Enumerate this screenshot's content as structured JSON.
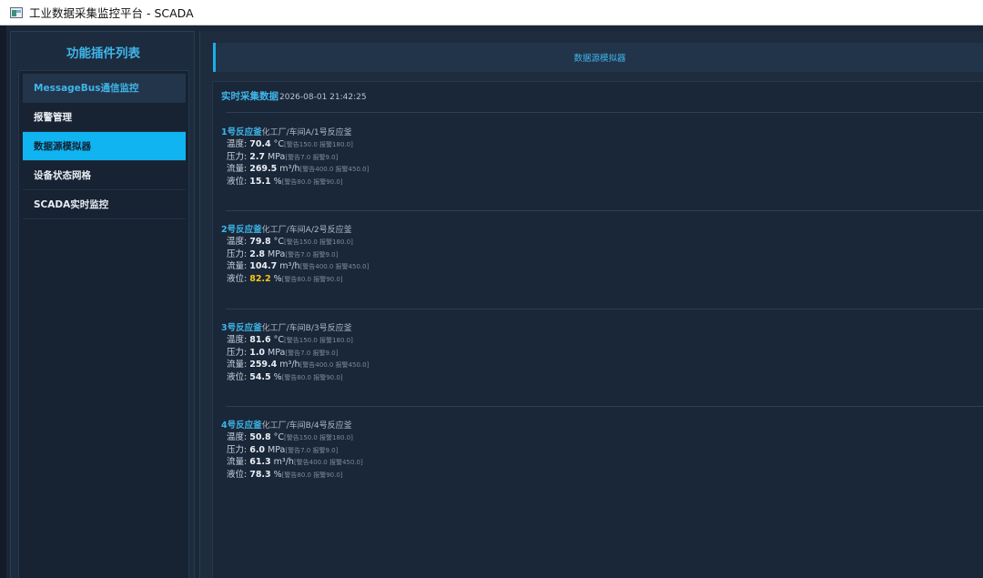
{
  "window": {
    "title": "工业数据采集监控平台 - SCADA"
  },
  "sidebar": {
    "title": "功能插件列表",
    "items": [
      {
        "label": "MessageBus通信监控"
      },
      {
        "label": "报警管理"
      },
      {
        "label": "数据源模拟器"
      },
      {
        "label": "设备状态网格"
      },
      {
        "label": "SCADA实时监控"
      }
    ]
  },
  "main": {
    "header_title": "数据源模拟器",
    "realtime": {
      "label": "实时采集数据",
      "timestamp": "2026-08-01 21:42:25"
    },
    "reactors": [
      {
        "name": "1号反应釜",
        "path": "化工厂/车间A/1号反应釜",
        "metrics": [
          {
            "label": "温度:",
            "value": "70.4",
            "unit": "°C",
            "thresholds": "[警告150.0 报警180.0]",
            "warn": false
          },
          {
            "label": "压力:",
            "value": "2.7",
            "unit": "MPa",
            "thresholds": "[警告7.0 报警9.0]",
            "warn": false
          },
          {
            "label": "流量:",
            "value": "269.5",
            "unit": "m³/h",
            "thresholds": "[警告400.0 报警450.0]",
            "warn": false
          },
          {
            "label": "液位:",
            "value": "15.1",
            "unit": "%",
            "thresholds": "[警告80.0 报警90.0]",
            "warn": false
          }
        ]
      },
      {
        "name": "2号反应釜",
        "path": "化工厂/车间A/2号反应釜",
        "metrics": [
          {
            "label": "温度:",
            "value": "79.8",
            "unit": "°C",
            "thresholds": "[警告150.0 报警180.0]",
            "warn": false
          },
          {
            "label": "压力:",
            "value": "2.8",
            "unit": "MPa",
            "thresholds": "[警告7.0 报警9.0]",
            "warn": false
          },
          {
            "label": "流量:",
            "value": "104.7",
            "unit": "m³/h",
            "thresholds": "[警告400.0 报警450.0]",
            "warn": false
          },
          {
            "label": "液位:",
            "value": "82.2",
            "unit": "%",
            "thresholds": "[警告80.0 报警90.0]",
            "warn": true
          }
        ]
      },
      {
        "name": "3号反应釜",
        "path": "化工厂/车间B/3号反应釜",
        "metrics": [
          {
            "label": "温度:",
            "value": "81.6",
            "unit": "°C",
            "thresholds": "[警告150.0 报警180.0]",
            "warn": false
          },
          {
            "label": "压力:",
            "value": "1.0",
            "unit": "MPa",
            "thresholds": "[警告7.0 报警9.0]",
            "warn": false
          },
          {
            "label": "流量:",
            "value": "259.4",
            "unit": "m³/h",
            "thresholds": "[警告400.0 报警450.0]",
            "warn": false
          },
          {
            "label": "液位:",
            "value": "54.5",
            "unit": "%",
            "thresholds": "[警告80.0 报警90.0]",
            "warn": false
          }
        ]
      },
      {
        "name": "4号反应釜",
        "path": "化工厂/车间B/4号反应釜",
        "metrics": [
          {
            "label": "温度:",
            "value": "50.8",
            "unit": "°C",
            "thresholds": "[警告150.0 报警180.0]",
            "warn": false
          },
          {
            "label": "压力:",
            "value": "6.0",
            "unit": "MPa",
            "thresholds": "[警告7.0 报警9.0]",
            "warn": false
          },
          {
            "label": "流量:",
            "value": "61.3",
            "unit": "m³/h",
            "thresholds": "[警告400.0 报警450.0]",
            "warn": false
          },
          {
            "label": "液位:",
            "value": "78.3",
            "unit": "%",
            "thresholds": "[警告80.0 报警90.0]",
            "warn": false
          }
        ]
      }
    ]
  },
  "colors": {
    "accent": "#0fb4f0",
    "warning": "#f5c518"
  },
  "icons": {
    "app": "scada-app-icon"
  }
}
